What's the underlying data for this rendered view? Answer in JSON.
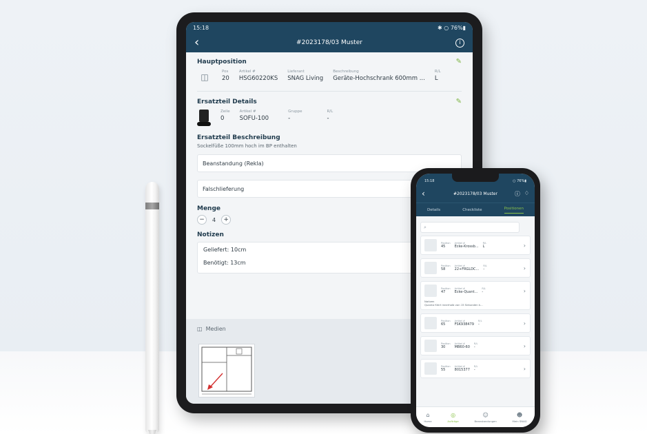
{
  "tablet": {
    "status": {
      "time": "15:18",
      "right": "✱ ○ 76%▮"
    },
    "header": {
      "title": "#2023178/03 Muster"
    },
    "hauptposition": {
      "title": "Hauptposition",
      "fields": [
        {
          "label": "Pos",
          "value": "20"
        },
        {
          "label": "Artikel #",
          "value": "HSG60220KS"
        },
        {
          "label": "Lieferant",
          "value": "SNAG Living"
        },
        {
          "label": "Beschreibung",
          "value": "Geräte-Hochschrank 600mm ..."
        },
        {
          "label": "R/L",
          "value": "L"
        }
      ]
    },
    "ersatzteil_details": {
      "title": "Ersatzteil Details",
      "fields": [
        {
          "label": "Zeile",
          "value": "0"
        },
        {
          "label": "Artikel #",
          "value": "SOFU-100"
        },
        {
          "label": "Gruppe",
          "value": "-"
        },
        {
          "label": "R/L",
          "value": "-"
        }
      ]
    },
    "beschreibung": {
      "title": "Ersatzteil Beschreibung",
      "text": "Sockelfüße 100mm hoch im BP enthalten"
    },
    "select_beanstandung": "Beanstandung (Rekla)",
    "select_grund": "Falschlieferung",
    "menge": {
      "title": "Menge",
      "value": "4",
      "minus": "−",
      "plus": "+"
    },
    "notizen": {
      "title": "Notizen",
      "lines": [
        "Geliefert: 10cm",
        "Benötigt: 13cm"
      ]
    },
    "medien": {
      "title": "Medien"
    }
  },
  "phone": {
    "status": {
      "time": "15:18",
      "right": "○ 76%▮"
    },
    "header": {
      "title": "#2023178/03 Muster"
    },
    "tabs": [
      {
        "label": "Details",
        "active": false
      },
      {
        "label": "Checkliste",
        "active": false
      },
      {
        "label": "Positionen",
        "active": true
      }
    ],
    "search_placeholder": "⌕",
    "list": [
      {
        "pos_label": "Position",
        "pos": "45",
        "art_label": "Artikel #",
        "art": "Ecke-Krossb...",
        "rl_label": "R/L",
        "rl": "L",
        "note": ""
      },
      {
        "pos_label": "Position",
        "pos": "58",
        "art_label": "Artikel #",
        "art": "22+FRGLDC...",
        "rl_label": "R/L",
        "rl": "-",
        "note": ""
      },
      {
        "pos_label": "Position",
        "pos": "47",
        "art_label": "Artikel #",
        "art": "Ecke-Quant...",
        "rl_label": "R/L",
        "rl": "-",
        "note_label": "Notizen",
        "note": "Quanta führt innerhalb von 15 Sekunden k..."
      },
      {
        "pos_label": "Position",
        "pos": "65",
        "art_label": "Artikel #",
        "art": "FSK938479",
        "rl_label": "R/L",
        "rl": "-",
        "note": ""
      },
      {
        "pos_label": "Position",
        "pos": "30",
        "art_label": "Artikel #",
        "art": "MB60-60",
        "rl_label": "R/L",
        "rl": "-",
        "note": ""
      },
      {
        "pos_label": "Position",
        "pos": "55",
        "art_label": "Artikel #",
        "art": "8015377",
        "rl_label": "R/L",
        "rl": "-",
        "note": ""
      }
    ],
    "nav": [
      {
        "label": "Home",
        "icon": "⌂",
        "active": false
      },
      {
        "label": "Aufträge",
        "icon": "◎",
        "active": true
      },
      {
        "label": "Beanstandungen",
        "icon": "☺",
        "active": false
      },
      {
        "label": "Mein SNAG",
        "icon": "☻",
        "active": false
      }
    ]
  },
  "colors": {
    "primary": "#1f4660",
    "accent": "#8bc34a"
  }
}
